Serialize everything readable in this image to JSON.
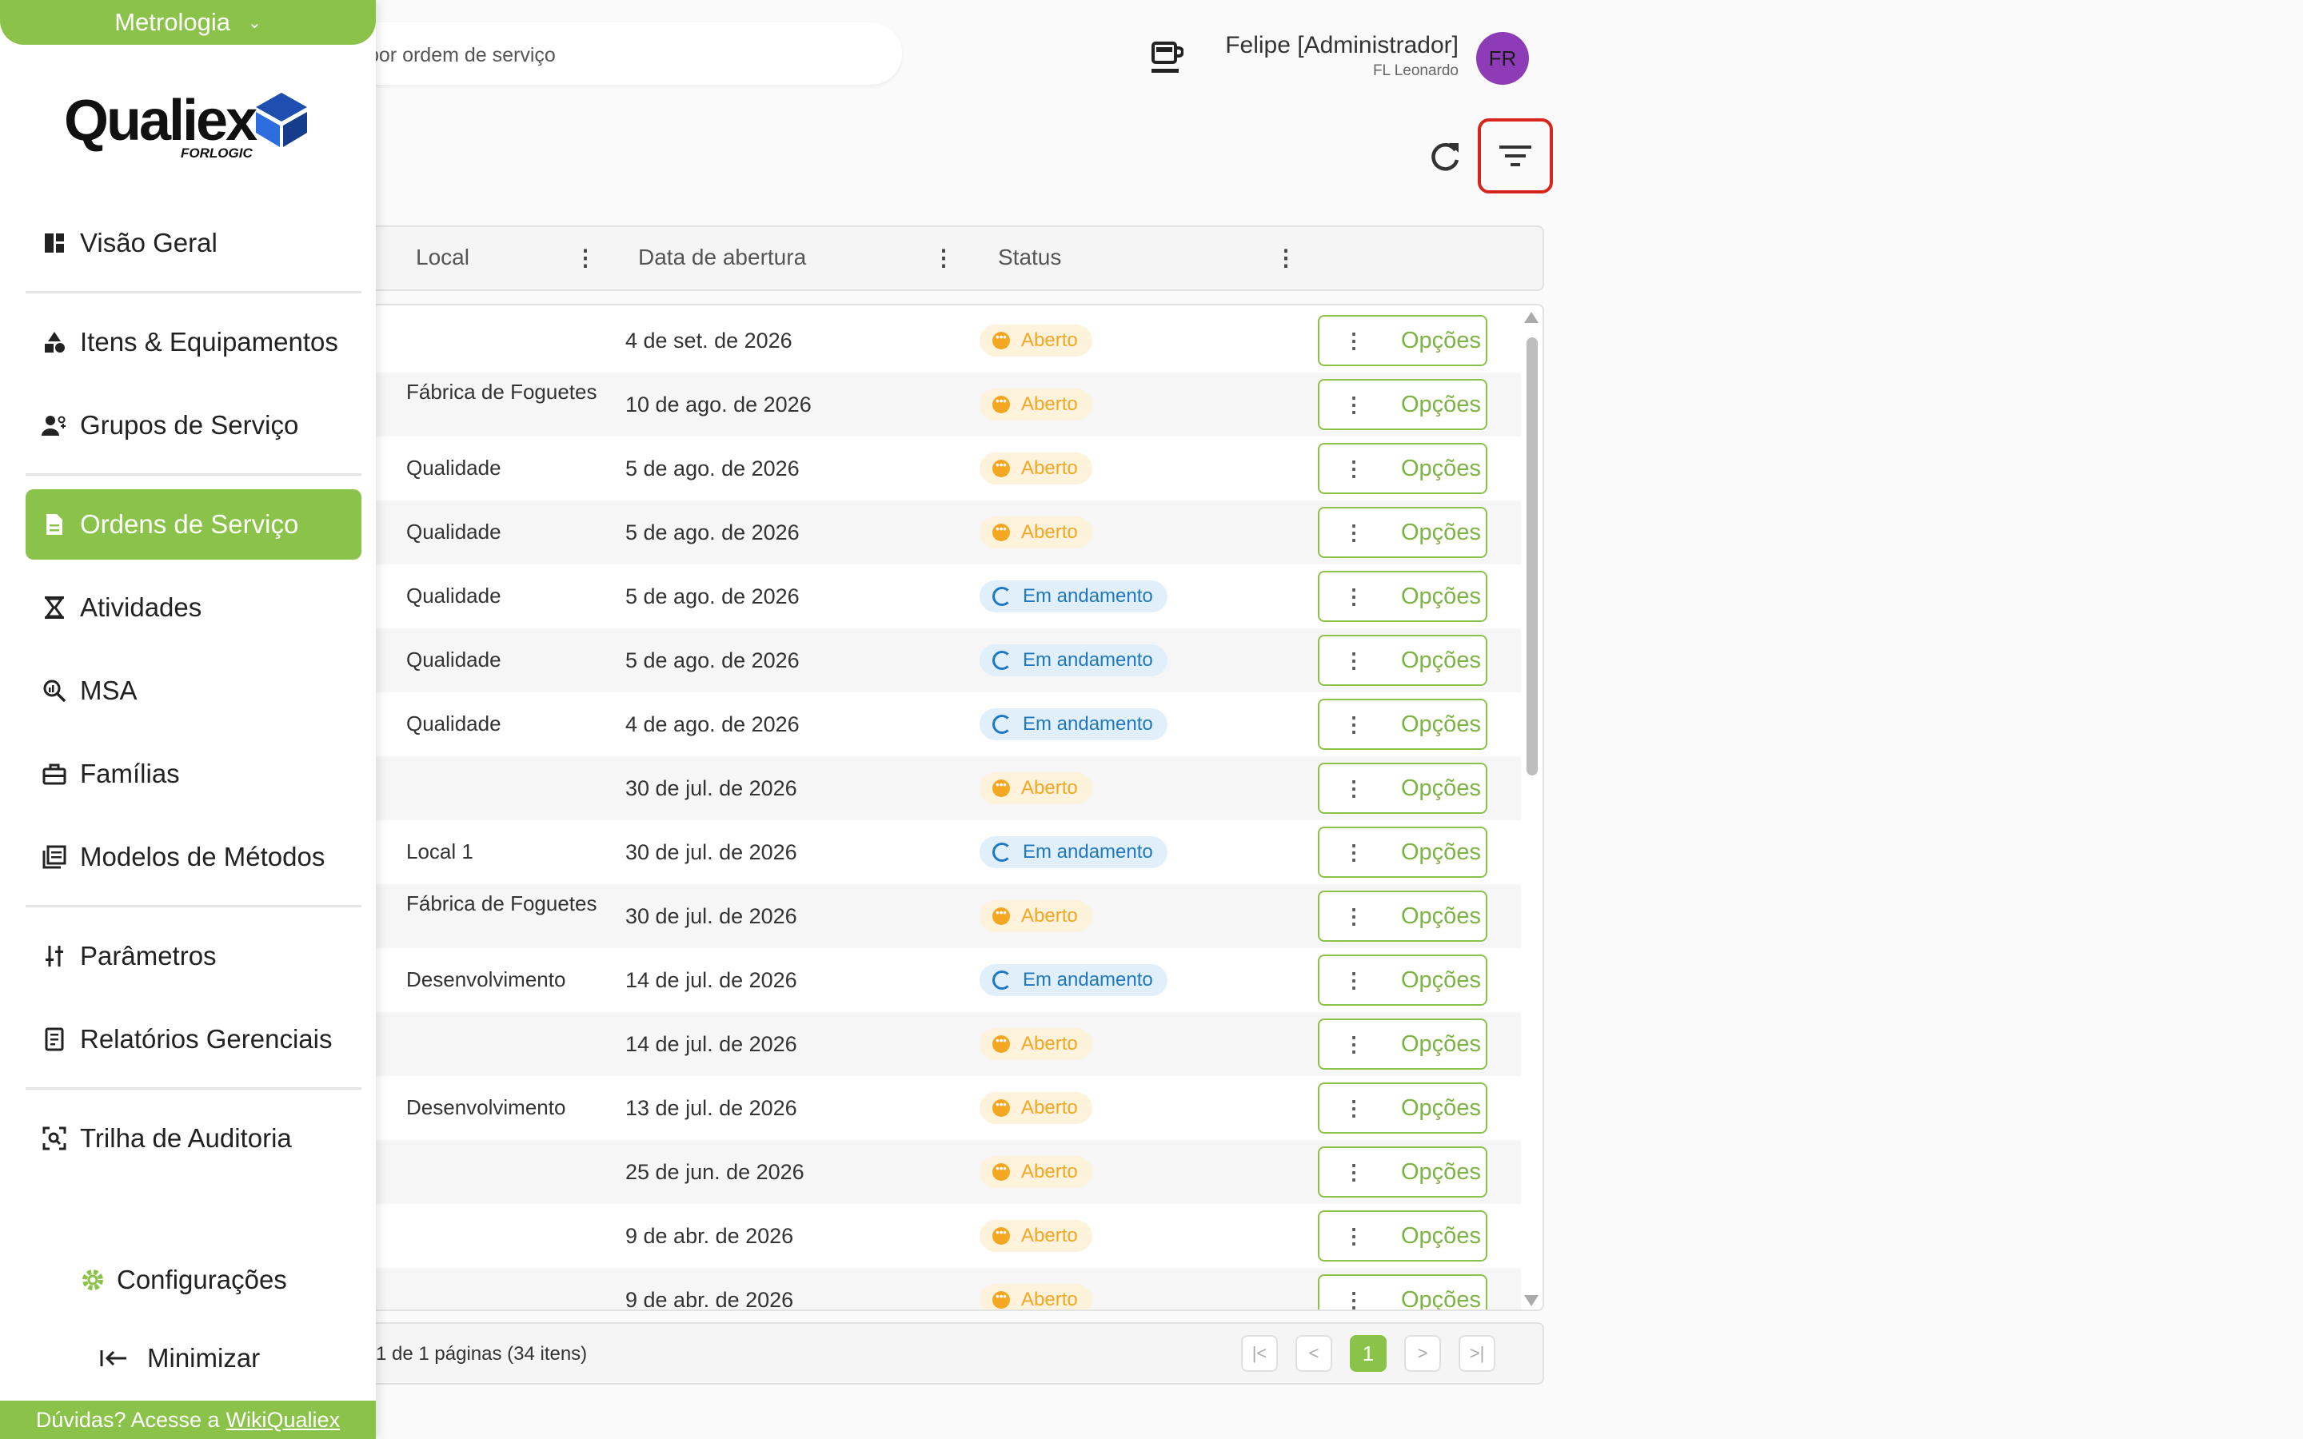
{
  "header": {
    "search_placeholder": "por ordem de serviço",
    "user_name": "Felipe [Administrador]",
    "user_org": "FL Leonardo",
    "avatar_initials": "FR"
  },
  "sidebar": {
    "module": "Metrologia",
    "logo": "Qualiex",
    "logo_sub": "FORLOGIC",
    "items": [
      {
        "label": "Visão Geral",
        "icon": "dashboard-icon"
      },
      {
        "label": "Itens & Equipamentos",
        "icon": "shapes-icon"
      },
      {
        "label": "Grupos de Serviço",
        "icon": "group-icon"
      },
      {
        "label": "Ordens de Serviço",
        "icon": "document-icon",
        "active": true
      },
      {
        "label": "Atividades",
        "icon": "hourglass-icon"
      },
      {
        "label": "MSA",
        "icon": "analytics-search-icon"
      },
      {
        "label": "Famílias",
        "icon": "toolbox-icon"
      },
      {
        "label": "Modelos de Métodos",
        "icon": "library-icon"
      },
      {
        "label": "Parâmetros",
        "icon": "sliders-icon"
      },
      {
        "label": "Relatórios Gerenciais",
        "icon": "report-icon"
      },
      {
        "label": "Trilha de Auditoria",
        "icon": "audit-icon"
      }
    ],
    "settings": "Configurações",
    "minimize": "Minimizar",
    "help_text": "Dúvidas? Acesse a",
    "help_link": "WikiQualiex"
  },
  "table": {
    "columns": [
      "Local",
      "Data de abertura",
      "Status"
    ],
    "options_label": "Opções",
    "rows": [
      {
        "local": "",
        "date": "4 de set. de 2026",
        "status": "Aberto"
      },
      {
        "local": "Fábrica de Foguetes",
        "date": "10 de ago. de 2026",
        "status": "Aberto"
      },
      {
        "local": "Qualidade",
        "date": "5 de ago. de 2026",
        "status": "Aberto"
      },
      {
        "local": "Qualidade",
        "date": "5 de ago. de 2026",
        "status": "Aberto"
      },
      {
        "local": "Qualidade",
        "date": "5 de ago. de 2026",
        "status": "Em andamento"
      },
      {
        "local": "Qualidade",
        "date": "5 de ago. de 2026",
        "status": "Em andamento"
      },
      {
        "local": "Qualidade",
        "date": "4 de ago. de 2026",
        "status": "Em andamento"
      },
      {
        "local": "",
        "date": "30 de jul. de 2026",
        "status": "Aberto"
      },
      {
        "local": "Local 1",
        "date": "30 de jul. de 2026",
        "status": "Em andamento"
      },
      {
        "local": "Fábrica de Foguetes",
        "date": "30 de jul. de 2026",
        "status": "Aberto"
      },
      {
        "local": "Desenvolvimento",
        "date": "14 de jul. de 2026",
        "status": "Em andamento"
      },
      {
        "local": "",
        "date": "14 de jul. de 2026",
        "status": "Aberto"
      },
      {
        "local": "Desenvolvimento",
        "date": "13 de jul. de 2026",
        "status": "Aberto"
      },
      {
        "local": "",
        "date": "25 de jun. de 2026",
        "status": "Aberto"
      },
      {
        "local": "",
        "date": "9 de abr. de 2026",
        "status": "Aberto"
      },
      {
        "local": "",
        "date": "9 de abr. de 2026",
        "status": "Aberto"
      }
    ]
  },
  "pagination": {
    "summary": "1 de 1 páginas (34 itens)",
    "current_page": "1"
  },
  "colors": {
    "accent": "#8bc34a",
    "open": "#f5a623",
    "in_progress": "#1f78c2",
    "highlight": "#d9231d"
  }
}
